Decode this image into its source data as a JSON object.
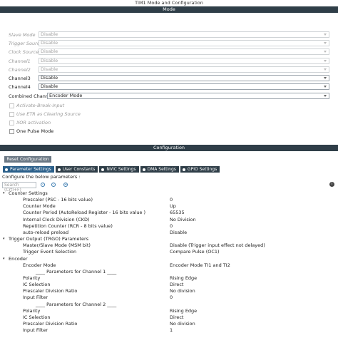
{
  "window": {
    "title": "TIM1 Mode and Configuration"
  },
  "mode": {
    "header": "Mode",
    "fields": [
      {
        "label": "Slave Mode",
        "value": "Disable",
        "enabled": false
      },
      {
        "label": "Trigger Source",
        "value": "Disable",
        "enabled": false
      },
      {
        "label": "Clock Source",
        "value": "Disable",
        "enabled": false
      },
      {
        "label": "Channel1",
        "value": "Disable",
        "enabled": false
      },
      {
        "label": "Channel2",
        "value": "Disable",
        "enabled": false
      },
      {
        "label": "Channel3",
        "value": "Disable",
        "enabled": true
      },
      {
        "label": "Channel4",
        "value": "Disable",
        "enabled": true
      },
      {
        "label": "Combined Channels",
        "value": "Encoder Mode",
        "enabled": true
      }
    ],
    "checkboxes": [
      {
        "label": "Activate-Break-Input",
        "enabled": false
      },
      {
        "label": "Use ETR as Clearing Source",
        "enabled": false
      },
      {
        "label": "XOR activation",
        "enabled": false
      },
      {
        "label": "One Pulse Mode",
        "enabled": true
      }
    ]
  },
  "configuration": {
    "header": "Configuration",
    "reset_label": "Reset Configuration",
    "tabs": [
      {
        "label": "Parameter Settings",
        "active": true
      },
      {
        "label": "User Constants",
        "active": false
      },
      {
        "label": "NVIC Settings",
        "active": false
      },
      {
        "label": "DMA Settings",
        "active": false
      },
      {
        "label": "GPIO Settings",
        "active": false
      }
    ],
    "hint": "Configure the below parameters :",
    "search_placeholder": "Search (Crtl+F)",
    "tree": [
      {
        "kind": "group",
        "name": "Counter Settings",
        "value": ""
      },
      {
        "kind": "child",
        "name": "Prescaler (PSC - 16 bits value)",
        "value": "0"
      },
      {
        "kind": "child",
        "name": "Counter Mode",
        "value": "Up"
      },
      {
        "kind": "child",
        "name": "Counter Period (AutoReload Register - 16 bits value )",
        "value": "65535"
      },
      {
        "kind": "child",
        "name": "Internal Clock Division (CKD)",
        "value": "No Division"
      },
      {
        "kind": "child",
        "name": "Repetition Counter (RCR - 8 bits value)",
        "value": "0"
      },
      {
        "kind": "child",
        "name": "auto-reload preload",
        "value": "Disable"
      },
      {
        "kind": "group",
        "name": "Trigger Output (TRGO) Parameters",
        "value": ""
      },
      {
        "kind": "child",
        "name": "Master/Slave Mode (MSM bit)",
        "value": "Disable (Trigger input effect not delayed)"
      },
      {
        "kind": "child",
        "name": "Trigger Event Selection",
        "value": "Compare Pulse (OC1)"
      },
      {
        "kind": "group",
        "name": "Encoder",
        "value": ""
      },
      {
        "kind": "child",
        "name": "Encoder Mode",
        "value": "Encoder Mode TI1 and TI2"
      },
      {
        "kind": "sub",
        "name": "____ Parameters for Channel 1 ____",
        "value": ""
      },
      {
        "kind": "child",
        "name": "Polarity",
        "value": "Rising Edge"
      },
      {
        "kind": "child",
        "name": "IC Selection",
        "value": "Direct"
      },
      {
        "kind": "child",
        "name": "Prescaler Division Ratio",
        "value": "No division"
      },
      {
        "kind": "child",
        "name": "Input Filter",
        "value": "0"
      },
      {
        "kind": "sub",
        "name": "____ Parameters for Channel 2 ____",
        "value": ""
      },
      {
        "kind": "child",
        "name": "Polarity",
        "value": "Rising Edge"
      },
      {
        "kind": "child",
        "name": "IC Selection",
        "value": "Direct"
      },
      {
        "kind": "child",
        "name": "Prescaler Division Ratio",
        "value": "No division"
      },
      {
        "kind": "child",
        "name": "Input Filter",
        "value": "1"
      }
    ]
  },
  "colors": {
    "section_bar": "#2f3e48",
    "active_tab": "#2a5f8a",
    "reset_button": "#6b7884"
  }
}
